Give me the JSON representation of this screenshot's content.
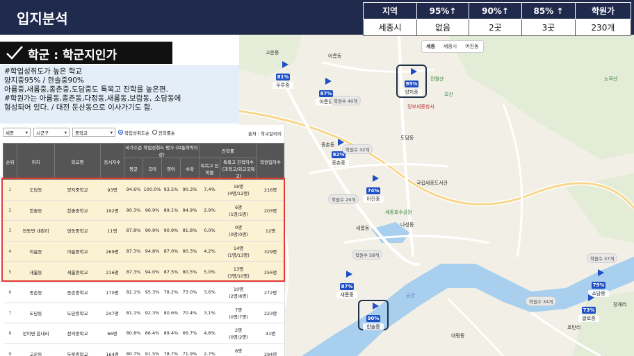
{
  "header": {
    "title": "입지분석"
  },
  "summary": {
    "headers": [
      "지역",
      "95%↑",
      "90%↑",
      "85% ↑",
      "학원가"
    ],
    "values": [
      "세종시",
      "없음",
      "2곳",
      "3곳",
      "230개"
    ]
  },
  "section": {
    "title": "학군 : 학군지인가"
  },
  "description": [
    "#학업성취도가 높은 학교",
    "양지중95% / 한솔중90%",
    "아름중,새롬중,종촌중,도담중도 특목고 진학률 높은편.",
    "#학원가는 아름동,종촌동,다정동,새롬동,보람동, 소담동에",
    "형성되어 있다. / 대전 둔산동으로 이사가기도 함."
  ],
  "filters": {
    "region": "세종",
    "district": "시군구",
    "level": "중학교",
    "radio1": "학업성취도순",
    "radio2": "진학률순",
    "source": "출처 : 학교알리미"
  },
  "table": {
    "header_top": {
      "rank": "순위",
      "location": "위치",
      "school": "학교명",
      "students": "응시자수",
      "achievement": "국가수준 학업성취도 평가 (보통학력이상)",
      "admission": "진학률",
      "academy": "학원업자수"
    },
    "header_sub": [
      "평균",
      "국어",
      "영어",
      "수학",
      "특목고 진학률",
      "특목고 진학자수 (과학고/외고국제고)"
    ],
    "rows": [
      {
        "rank": "1",
        "loc": "도담동",
        "school": "양지중학교",
        "n": "93명",
        "avg": "94.6%",
        "kor": "100.0%",
        "eng": "93.5%",
        "math": "90.3%",
        "rate": "7.4%",
        "cnt1": "16명",
        "cnt2": "(4명/12명)",
        "acad": "216명"
      },
      {
        "rank": "2",
        "loc": "한솔동",
        "school": "한솔중학교",
        "n": "192명",
        "avg": "90.3%",
        "kor": "96.9%",
        "eng": "89.1%",
        "math": "84.9%",
        "rate": "2.9%",
        "cnt1": "6명",
        "cnt2": "(1명/5명)",
        "acad": "203명"
      },
      {
        "rank": "3",
        "loc": "연동면 내판리",
        "school": "연동중학교",
        "n": "11명",
        "avg": "87.8%",
        "kor": "90.9%",
        "eng": "90.9%",
        "math": "81.8%",
        "rate": "0.0%",
        "cnt1": "0명",
        "cnt2": "(0명/0명)",
        "acad": "12명"
      },
      {
        "rank": "4",
        "loc": "아름동",
        "school": "아름중학교",
        "n": "269명",
        "avg": "87.3%",
        "kor": "94.8%",
        "eng": "87.0%",
        "math": "80.3%",
        "rate": "4.2%",
        "cnt1": "14명",
        "cnt2": "(1명/13명)",
        "acad": "329명"
      },
      {
        "rank": "5",
        "loc": "새롬동",
        "school": "새롬중학교",
        "n": "216명",
        "avg": "87.3%",
        "kor": "94.0%",
        "eng": "87.5%",
        "math": "80.5%",
        "rate": "5.0%",
        "cnt1": "13명",
        "cnt2": "(3명/10명)",
        "acad": "255명"
      },
      {
        "rank": "6",
        "loc": "종촌동",
        "school": "종촌중학교",
        "n": "170명",
        "avg": "82.1%",
        "kor": "95.3%",
        "eng": "78.2%",
        "math": "73.0%",
        "rate": "3.6%",
        "cnt1": "10명",
        "cnt2": "(2명/8명)",
        "acad": "272명"
      },
      {
        "rank": "7",
        "loc": "도담동",
        "school": "도담중학교",
        "n": "247명",
        "avg": "81.1%",
        "kor": "92.3%",
        "eng": "80.6%",
        "math": "70.4%",
        "rate": "3.1%",
        "cnt1": "7명",
        "cnt2": "(0명/7명)",
        "acad": "223명"
      },
      {
        "rank": "8",
        "loc": "전의면 읍내리",
        "school": "전의중학교",
        "n": "66명",
        "avg": "80.8%",
        "kor": "86.4%",
        "eng": "89.4%",
        "math": "66.7%",
        "rate": "4.8%",
        "cnt1": "2명",
        "cnt2": "(0명/2명)",
        "acad": "41명"
      },
      {
        "rank": "9",
        "loc": "고운동",
        "school": "두루중학교",
        "n": "164명",
        "avg": "80.7%",
        "kor": "91.5%",
        "eng": "78.7%",
        "math": "71.9%",
        "rate": "2.7%",
        "cnt1": "8명",
        "cnt2": "(3명/5명)",
        "acad": "294명"
      }
    ]
  },
  "map": {
    "tabs": [
      "세종",
      "세종시",
      "어진동"
    ],
    "pins": [
      {
        "pct": "81%",
        "name": "두루중"
      },
      {
        "pct": "87%",
        "name": "아름중"
      },
      {
        "pct": "95%",
        "name": "양지중"
      },
      {
        "pct": "82%",
        "name": "종촌중"
      },
      {
        "pct": "74%",
        "name": "어진중"
      },
      {
        "pct": "87%",
        "name": "새롬중"
      },
      {
        "pct": "90%",
        "name": "한솔중"
      },
      {
        "pct": "79%",
        "name": "소담중"
      },
      {
        "pct": "73%",
        "name": "글로중"
      }
    ],
    "counts": [
      "학원수 40개",
      "학원수 32개",
      "학원수 29개",
      "학원수 58개",
      "학원수 34개",
      "학원수 37개"
    ],
    "places": {
      "goundong": "고운동",
      "areumdong": "아름동",
      "jongchon": "종촌동",
      "dodam": "도담동",
      "areum_apt": "아름동",
      "nasung": "나성동",
      "saerom": "새롬동",
      "daepyeong": "대평동",
      "bangchuk": "방축천",
      "geum": "금강",
      "hosu": "세종호수공원",
      "jeonwol": "전월산",
      "nojeoksan": "노적산",
      "osan": "오산",
      "jangjae": "장재리",
      "hotanri": "호탄리",
      "gov": "정부세종청사",
      "gunmun": "국립세종도서관"
    }
  }
}
